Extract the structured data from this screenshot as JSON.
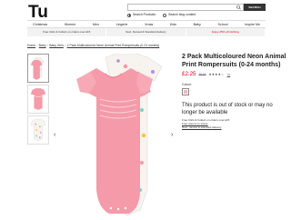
{
  "header": {
    "logo_text": "Tu",
    "search": {
      "placeholder": "",
      "button_label": "SEARCH",
      "options": [
        {
          "label": "Search Products",
          "selected": true
        },
        {
          "label": "Search blog content",
          "selected": false
        }
      ]
    }
  },
  "nav": {
    "items": [
      "Christmas",
      "Women",
      "Men",
      "Lingerie",
      "Xmas",
      "Kids",
      "Baby",
      "School",
      "Inspire Me"
    ]
  },
  "promo": {
    "items": [
      {
        "text": "Free Click & Collect on orders over £15",
        "highlight": false
      },
      {
        "text": "Next, Named & Standard delivery",
        "highlight": false
      },
      {
        "text": "Enjoy 25% off clothing",
        "highlight": true
      }
    ]
  },
  "breadcrumb": {
    "items": [
      "Home",
      "Baby",
      "Baby Girls"
    ],
    "current": "2 Pack Multicoloured Neon Animal Print Rompersuits (0-24 months)"
  },
  "product": {
    "title": "2 Pack Multicoloured Neon Animal Print Rompersuits (0-24 months)",
    "price": "£2.25",
    "was_price": "£9.00",
    "rating_stars": "★★★★☆",
    "rating": 4,
    "reviews": "(1)",
    "colour_label": "Colour:",
    "colour_hex": "#f5b5c1",
    "out_of_stock": "This product is out of stock or may no longer be available",
    "info_lines": [
      "Free Click & Collect on orders over £15",
      "Free returns to stores",
      "Next, named & standard delivery"
    ]
  },
  "gallery": {
    "prev_icon": "chevron-left-icon",
    "next_icon": "chevron-right-icon"
  },
  "colors": {
    "accent_red": "#d4000f",
    "romper_pink": "#f59aa8",
    "search_button": "#333333"
  }
}
